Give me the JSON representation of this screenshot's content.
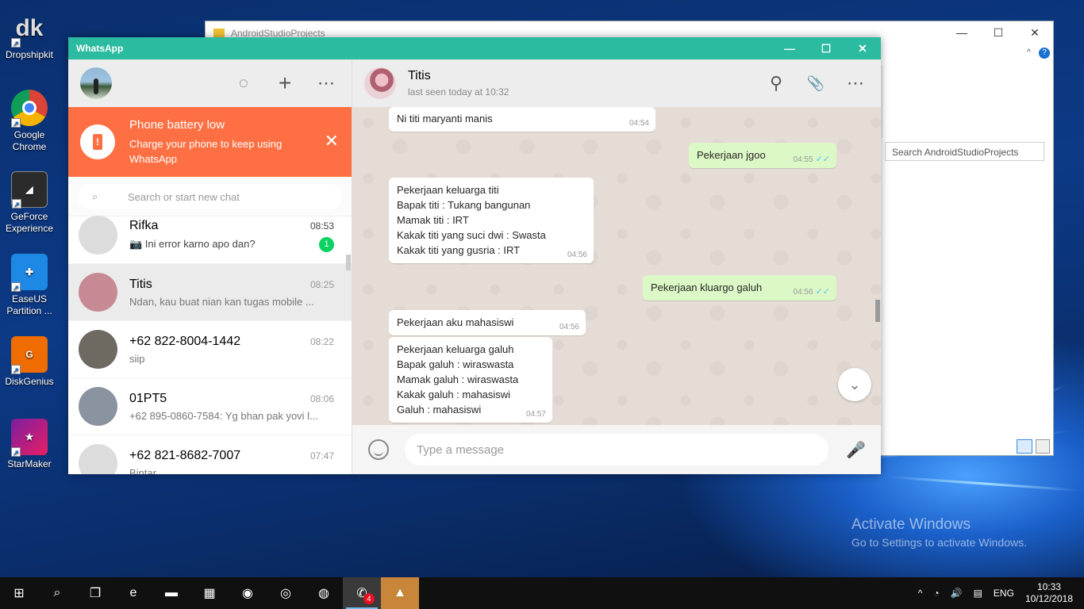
{
  "desktop": {
    "icons": [
      {
        "label": "Dropshipkit",
        "icon": "dropshipkit-icon",
        "color": "#555555"
      },
      {
        "label": "Google Chrome",
        "icon": "chrome-icon",
        "color": "#db4437"
      },
      {
        "label": "GeForce Experience",
        "icon": "geforce-icon",
        "color": "#333333"
      },
      {
        "label": "EaseUS Partition ...",
        "icon": "easeus-icon",
        "color": "#1e88e5"
      },
      {
        "label": "DiskGenius",
        "icon": "diskgenius-icon",
        "color": "#ef6c00"
      },
      {
        "label": "StarMaker",
        "icon": "starmaker-icon",
        "color": "#c2185b"
      }
    ],
    "activation": {
      "title": "Activate Windows",
      "subtitle": "Go to Settings to activate Windows."
    }
  },
  "explorer": {
    "title": "AndroidStudioProjects",
    "search_placeholder": "Search AndroidStudioProjects",
    "minimize": "—",
    "maximize": "☐",
    "close": "✕",
    "help": "?",
    "collapse": "^"
  },
  "whatsapp": {
    "window_title": "WhatsApp",
    "controls": {
      "minimize": "—",
      "maximize": "☐",
      "close": "✕"
    },
    "header_icons": {
      "status": "◌",
      "new_chat": "+",
      "menu": "⋯"
    },
    "battery": {
      "title": "Phone battery low",
      "text": "Charge your phone to keep using WhatsApp",
      "icon": "!",
      "close": "✕"
    },
    "search": {
      "placeholder": "Search or start new chat",
      "icon": "⌕"
    },
    "chats": [
      {
        "name": "Rifka",
        "time": "08:53",
        "preview": "📷 Ini error karno apo dan?",
        "unread": "1",
        "avatar": "#dcdcdc"
      },
      {
        "name": "Titis",
        "time": "08:25",
        "preview": "Ndan, kau buat nian kan tugas mobile ...",
        "unread": "",
        "avatar": "#c78a94"
      },
      {
        "name": "+62 822-8004-1442",
        "time": "08:22",
        "preview": "siip",
        "unread": "",
        "avatar": "#6e6a62"
      },
      {
        "name": "01PT5",
        "time": "08:06",
        "preview": "+62 895-0860-7584: Yg bhan pak yovi l...",
        "unread": "",
        "avatar": "#8a93a0"
      },
      {
        "name": "+62 821-8682-7007",
        "time": "07:47",
        "preview": "Bintar",
        "unread": "",
        "avatar": "#dcdcdc"
      }
    ],
    "conversation": {
      "name": "Titis",
      "status": "last seen today at 10:32",
      "icons": {
        "search": "⚲",
        "attach": "📎",
        "menu": "⋯"
      },
      "messages": [
        {
          "dir": "in",
          "text": "Ni titi maryanti manis",
          "time": "04:54"
        },
        {
          "dir": "out",
          "text": "Pekerjaan jgoo",
          "time": "04:55"
        },
        {
          "dir": "in",
          "text": "Pekerjaan keluarga titi\nBapak titi : Tukang bangunan\nMamak titi : IRT\nKakak titi yang suci dwi : Swasta\nKakak titi yang gusria : IRT",
          "time": "04:56"
        },
        {
          "dir": "out",
          "text": "Pekerjaan kluargo galuh",
          "time": "04:56"
        },
        {
          "dir": "in",
          "text": "Pekerjaan aku mahasiswi",
          "time": "04:56"
        },
        {
          "dir": "in",
          "text": "Pekerjaan keluarga galuh\nBapak galuh : wiraswasta\nMamak galuh : wiraswasta\nKakak galuh : mahasiswi\nGaluh : mahasiswi",
          "time": "04:57"
        }
      ],
      "ticks": "✓✓",
      "scroll_down": "⌄",
      "composer_placeholder": "Type a message",
      "mic": "🎤"
    }
  },
  "taskbar": {
    "items": [
      {
        "name": "start-button",
        "glyph": "⊞"
      },
      {
        "name": "search-button",
        "glyph": "⌕"
      },
      {
        "name": "task-view-button",
        "glyph": "❐"
      },
      {
        "name": "edge-app",
        "glyph": "e"
      },
      {
        "name": "file-explorer-app",
        "glyph": "▬"
      },
      {
        "name": "store-app",
        "glyph": "▦"
      },
      {
        "name": "firefox-app",
        "glyph": "◉"
      },
      {
        "name": "uc-browser-app",
        "glyph": "◎"
      },
      {
        "name": "chrome-app",
        "glyph": "◍"
      },
      {
        "name": "whatsapp-app",
        "glyph": "✆"
      },
      {
        "name": "android-studio-app",
        "glyph": "▲"
      }
    ],
    "whatsapp_count": "4",
    "tray": {
      "lang": "ENG",
      "time": "10:33",
      "date": "10/12/2018"
    }
  }
}
